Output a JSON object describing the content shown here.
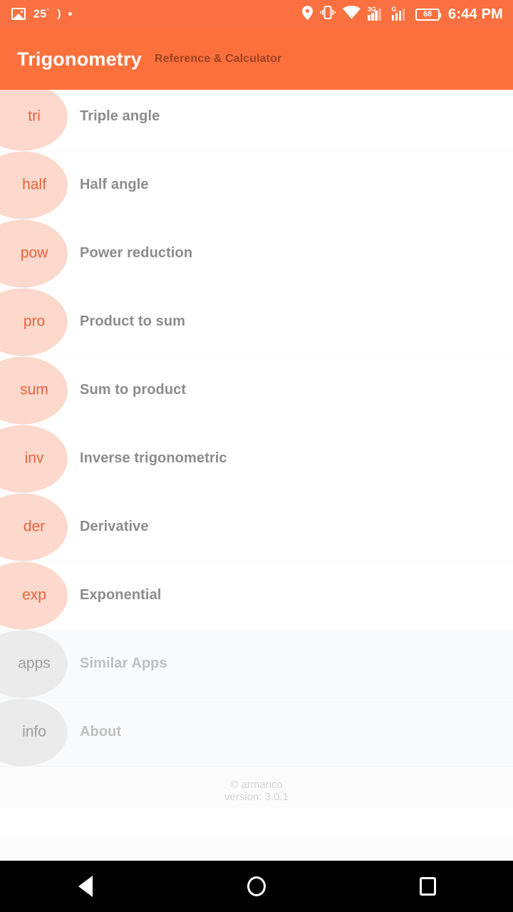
{
  "status_bar": {
    "image_icon": "image-icon",
    "temperature": "25",
    "degree_symbol": "°",
    "moon_glyph": ")",
    "dot_glyph": "•",
    "location_icon": "location-pin-icon",
    "vibrate_icon": "vibrate-icon",
    "wifi_icon": "wifi-icon",
    "signal_1_label": "3G",
    "signal_2_label": "G",
    "battery_level": "68",
    "time": "6:44 PM"
  },
  "header": {
    "title": "Trigonometry",
    "subtitle": "Reference & Calculator",
    "background_color": "#FC703C",
    "title_color": "#FFFFFF",
    "subtitle_color": "#9C4326"
  },
  "list": {
    "items": [
      {
        "badge": "tri",
        "label": "Triple angle",
        "style": "primary"
      },
      {
        "badge": "half",
        "label": "Half angle",
        "style": "primary"
      },
      {
        "badge": "pow",
        "label": "Power reduction",
        "style": "primary"
      },
      {
        "badge": "pro",
        "label": "Product to sum",
        "style": "primary"
      },
      {
        "badge": "sum",
        "label": "Sum to product",
        "style": "primary"
      },
      {
        "badge": "inv",
        "label": "Inverse trigonometric",
        "style": "primary"
      },
      {
        "badge": "der",
        "label": "Derivative",
        "style": "primary"
      },
      {
        "badge": "exp",
        "label": "Exponential",
        "style": "primary"
      },
      {
        "badge": "apps",
        "label": "Similar Apps",
        "style": "secondary"
      },
      {
        "badge": "info",
        "label": "About",
        "style": "secondary"
      }
    ],
    "badge_color": "#FCD9CC",
    "badge_text_color": "#E8623E",
    "badge_color_secondary": "#EBEBEB",
    "badge_text_color_secondary": "#9E9E9E",
    "label_color": "#8C8C8C"
  },
  "footer": {
    "copyright": "© armanco",
    "version": "version: 3.0.1"
  },
  "navbar": {
    "back": "back-triangle-icon",
    "home": "home-circle-icon",
    "recents": "recents-square-icon"
  }
}
